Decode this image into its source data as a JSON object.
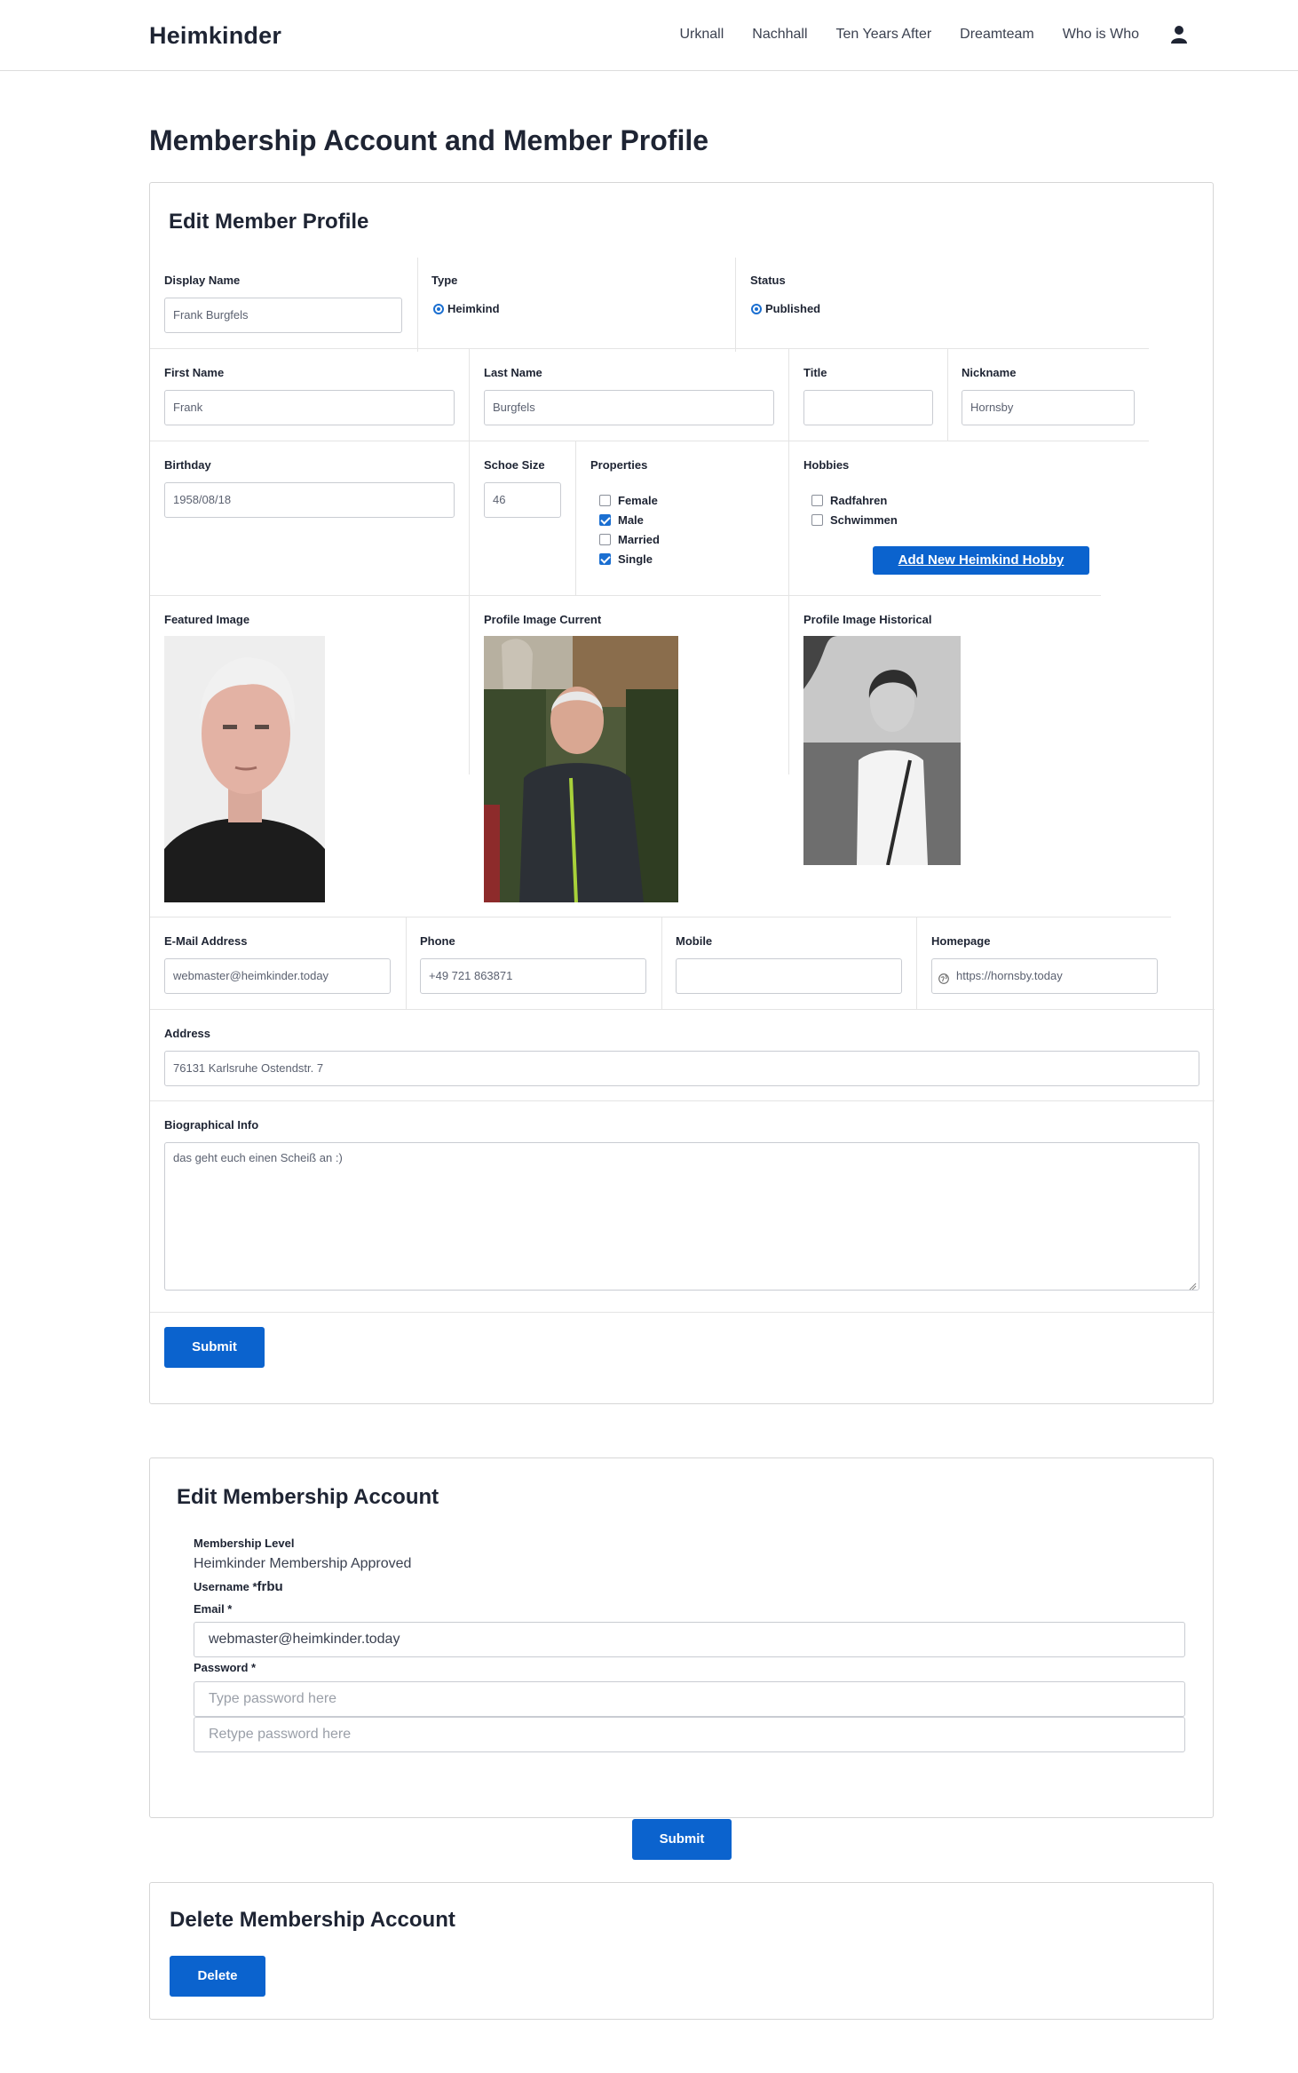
{
  "header": {
    "brand": "Heimkinder",
    "nav": [
      "Urknall",
      "Nachhall",
      "Ten Years After",
      "Dreamteam",
      "Who is Who"
    ],
    "user_icon": "user-icon"
  },
  "page_title": "Membership Account and Member Profile",
  "profile": {
    "title": "Edit Member Profile",
    "display_name": {
      "label": "Display Name",
      "value": "Frank Burgfels"
    },
    "type": {
      "label": "Type",
      "option": "Heimkind"
    },
    "status": {
      "label": "Status",
      "option": "Published"
    },
    "first_name": {
      "label": "First Name",
      "value": "Frank"
    },
    "last_name": {
      "label": "Last Name",
      "value": "Burgfels"
    },
    "title_field": {
      "label": "Title",
      "value": ""
    },
    "nickname": {
      "label": "Nickname",
      "value": "Hornsby"
    },
    "birthday": {
      "label": "Birthday",
      "value": "1958/08/18"
    },
    "shoe_size": {
      "label": "Schoe Size",
      "value": "46"
    },
    "properties": {
      "label": "Properties",
      "items": [
        {
          "label": "Female",
          "checked": false
        },
        {
          "label": "Male",
          "checked": true
        },
        {
          "label": "Married",
          "checked": false
        },
        {
          "label": "Single",
          "checked": true
        }
      ]
    },
    "hobbies": {
      "label": "Hobbies",
      "items": [
        {
          "label": "Radfahren",
          "checked": false
        },
        {
          "label": "Schwimmen",
          "checked": false
        }
      ],
      "add_button": "Add New Heimkind Hobby"
    },
    "featured_image": {
      "label": "Featured Image"
    },
    "profile_image_current": {
      "label": "Profile Image Current"
    },
    "profile_image_historical": {
      "label": "Profile Image Historical"
    },
    "email": {
      "label": "E-Mail Address",
      "value": "webmaster@heimkinder.today"
    },
    "phone": {
      "label": "Phone",
      "value": "+49 721 863871"
    },
    "mobile": {
      "label": "Mobile",
      "value": ""
    },
    "homepage": {
      "label": "Homepage",
      "value": "https://hornsby.today",
      "icon": "globe-icon"
    },
    "address": {
      "label": "Address",
      "value": "76131 Karlsruhe Ostendstr. 7"
    },
    "bio": {
      "label": "Biographical Info",
      "value": "das geht euch einen Scheiß an :)"
    },
    "submit": "Submit"
  },
  "account": {
    "title": "Edit Membership Account",
    "level_label": "Membership Level",
    "level_value": "Heimkinder Membership Approved",
    "username_label": "Username *",
    "username_value": "frbu",
    "email_label": "Email *",
    "email_value": "webmaster@heimkinder.today",
    "password_label": "Password *",
    "password_placeholder": "Type password here",
    "password_retype_placeholder": "Retype password here",
    "submit": "Submit"
  },
  "delete": {
    "title": "Delete Membership Account",
    "button": "Delete"
  },
  "colors": {
    "accent": "#0b63ce",
    "text": "#1e2433",
    "border": "#d6d6d6"
  }
}
